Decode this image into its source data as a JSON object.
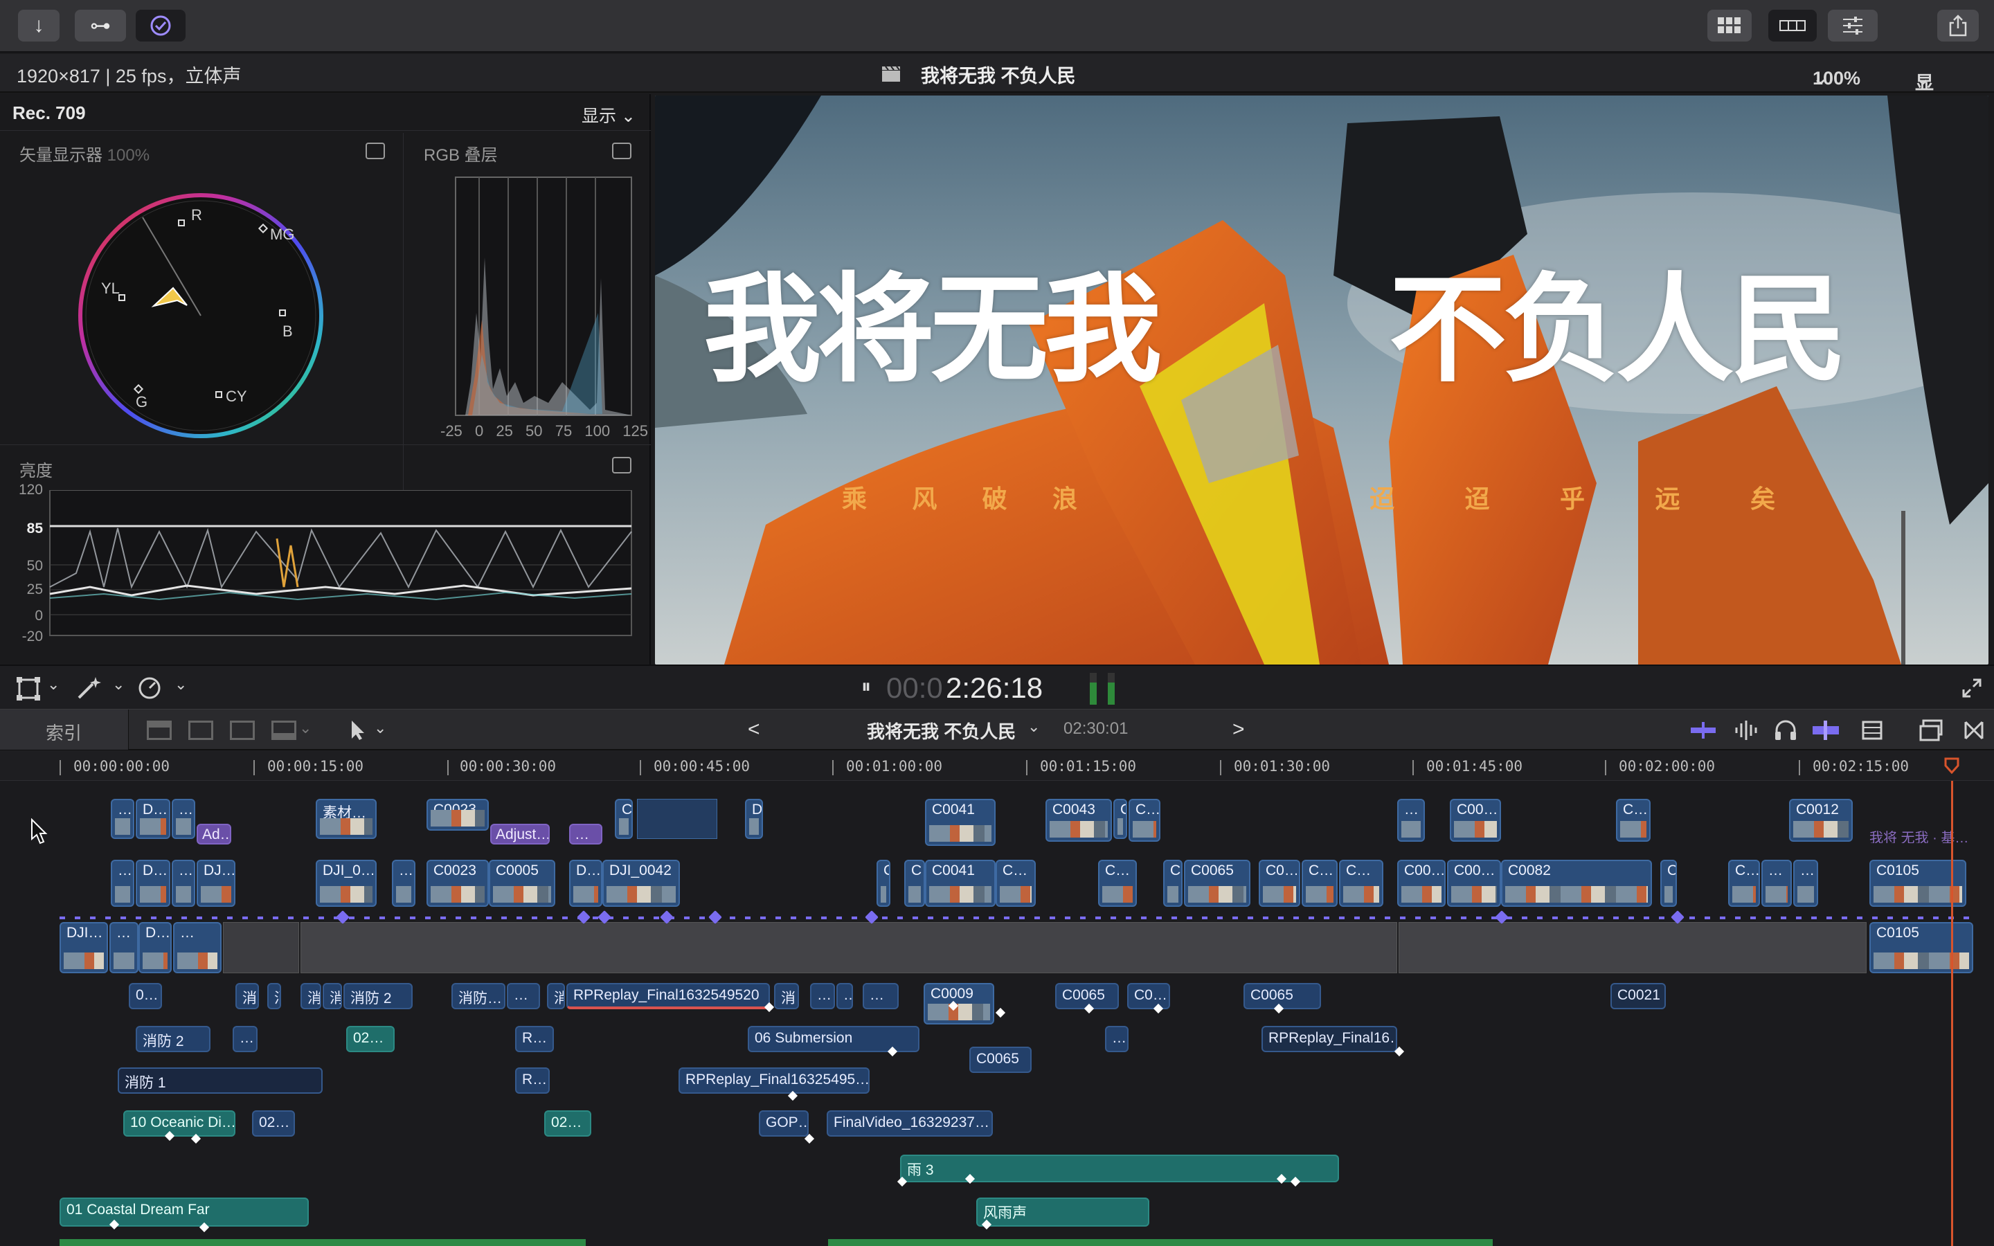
{
  "toolbar": {
    "import_icon": "↓",
    "keyword_icon": "⊶",
    "background_tasks_icon": "✓",
    "grid_icon": "▦",
    "filmstrip_icon": "▭",
    "inspector_icon": "⚙",
    "share_icon": "⇪"
  },
  "infobar": {
    "format": "1920×817 | 25 fps，立体声",
    "project_title": "我将无我 不负人民",
    "zoom": "100%",
    "view_menu": "显示"
  },
  "scopes": {
    "color_space": "Rec. 709",
    "view_menu": "显示",
    "vectorscope_title": "矢量显示器",
    "vectorscope_pct": "100%",
    "vector_labels": {
      "r": "R",
      "mg": "MG",
      "yl": "YL",
      "b": "B",
      "g": "G",
      "cy": "CY"
    },
    "rgb_title": "RGB 叠层",
    "rgb_ticks": [
      "-25",
      "0",
      "25",
      "50",
      "75",
      "100",
      "125"
    ],
    "luma_title": "亮度",
    "luma_ticks": [
      "120",
      "85",
      "50",
      "25",
      "0",
      "-20"
    ]
  },
  "viewer": {
    "title_big_left": "我将无我",
    "title_big_right": "不负人民",
    "subtitle_chars": [
      "乘",
      "风",
      "破",
      "浪",
      "迢",
      "迢",
      "乎",
      "远",
      "矣"
    ]
  },
  "transport": {
    "timecode_dim": "00:0",
    "timecode": "2:26:18",
    "play_icon": "⏸"
  },
  "timeline_bar": {
    "index_label": "索引",
    "project_name": "我将无我 不负人民",
    "duration": "02:30:01",
    "prev_icon": "<",
    "next_icon": ">"
  },
  "ruler": [
    "00:00:00:00",
    "00:00:15:00",
    "00:00:30:00",
    "00:00:45:00",
    "00:01:00:00",
    "00:01:15:00",
    "00:01:30:00",
    "00:01:45:00",
    "00:02:00:00",
    "00:02:15:00"
  ],
  "clips": {
    "row1": [
      "…",
      "D…",
      "…",
      "素材…",
      "C0023",
      "C",
      "D",
      "C0041",
      "C0043",
      "C",
      "C…",
      "C…",
      "…",
      "C00…",
      "C…",
      "C0012",
      "我将 无我 · 基…"
    ],
    "adj": [
      "Ad…",
      "Adjust…",
      "…"
    ],
    "row2": [
      "…",
      "D…",
      "…",
      "DJ…",
      "DJI_0…",
      "…",
      "C0023",
      "C0005",
      "D…",
      "DJI_0042",
      "C",
      "C",
      "C0041",
      "C…",
      "C…",
      "C",
      "C0065",
      "C0…",
      "C…",
      "C…",
      "C00…",
      "C00…",
      "C0082",
      "C",
      "C…",
      "…",
      "…",
      "C0105"
    ],
    "primary": [
      "DJI…",
      "…",
      "D…",
      "…",
      "C0105"
    ],
    "conn1": [
      "0…",
      "消",
      "消",
      "消",
      "消防 2",
      "消防…",
      "…",
      "消",
      "RPReplay_Final1632549520",
      "消",
      "…",
      "…",
      "…",
      "C0009",
      "C0065",
      "C0…",
      "C0065",
      "C0021"
    ],
    "conn2": [
      "消防 2",
      "…",
      "02…",
      "R…",
      "06 Submersion",
      "…",
      "RPReplay_Final16…",
      "C0065"
    ],
    "conn3": [
      "消防 1",
      "R…",
      "RPReplay_Final16325495…"
    ],
    "conn4": [
      "10 Oceanic Di…",
      "02…",
      "02…",
      "GOP…",
      "FinalVideo_16329237…"
    ],
    "audio": [
      "雨 3",
      "01 Coastal Dream Far",
      "风雨声"
    ]
  }
}
